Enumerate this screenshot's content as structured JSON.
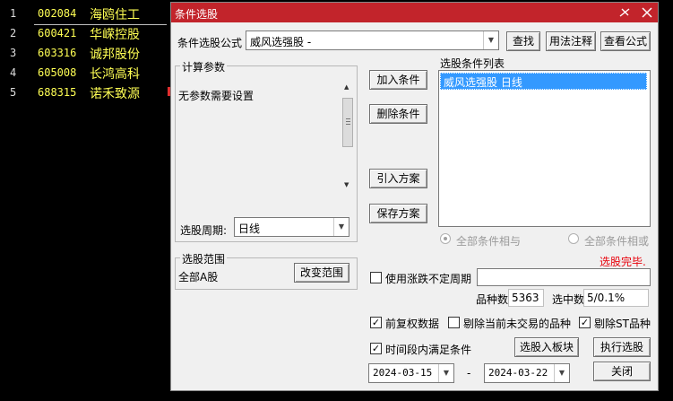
{
  "stock_list": [
    {
      "index": "1",
      "code": "002084",
      "name": "海鸥住工"
    },
    {
      "index": "2",
      "code": "600421",
      "name": "华嵘控股"
    },
    {
      "index": "3",
      "code": "603316",
      "name": "诚邦股份"
    },
    {
      "index": "4",
      "code": "605008",
      "name": "长鸿高科"
    },
    {
      "index": "5",
      "code": "688315",
      "name": "诺禾致源"
    }
  ],
  "dialog": {
    "title": "条件选股",
    "formula_label": "条件选股公式",
    "formula_value": "威风选强股  -",
    "find_button": "查找",
    "usage_button": "用法注释",
    "view_formula_button": "查看公式",
    "params_group_title": "计算参数",
    "params_text": "无参数需要设置",
    "period_label": "选股周期:",
    "period_value": "日线",
    "add_condition": "加入条件",
    "delete_condition": "删除条件",
    "import_plan": "引入方案",
    "save_plan": "保存方案",
    "condition_list_title": "选股条件列表",
    "condition_items": [
      "威风选强股  日线"
    ],
    "radio_and": "全部条件相与",
    "radio_or": "全部条件相或",
    "status_text": "选股完毕.",
    "range_group_title": "选股范围",
    "range_value": "全部A股",
    "change_range_button": "改变范围",
    "variable_period_label": "使用涨跌不定周期",
    "variable_period_value": "",
    "count_label": "品种数",
    "count_value": "5363",
    "selected_label": "选中数",
    "selected_value": "5/0.1%",
    "pre_adjust_label": "前复权数据",
    "exclude_untraded_label": "剔除当前未交易的品种",
    "exclude_st_label": "剔除ST品种",
    "time_period_label": "时间段内满足条件",
    "to_board_button": "选股入板块",
    "execute_button": "执行选股",
    "start_date": "2024-03-15",
    "date_sep": "-",
    "end_date": "2024-03-22",
    "close_button": "关闭",
    "checkboxes": {
      "variable_period": false,
      "pre_adjust": true,
      "exclude_untraded": false,
      "exclude_st": true,
      "time_period": true
    },
    "colors": {
      "titlebar": "#c2242b",
      "status": "#e8000a",
      "selection": "#3399ff"
    }
  }
}
